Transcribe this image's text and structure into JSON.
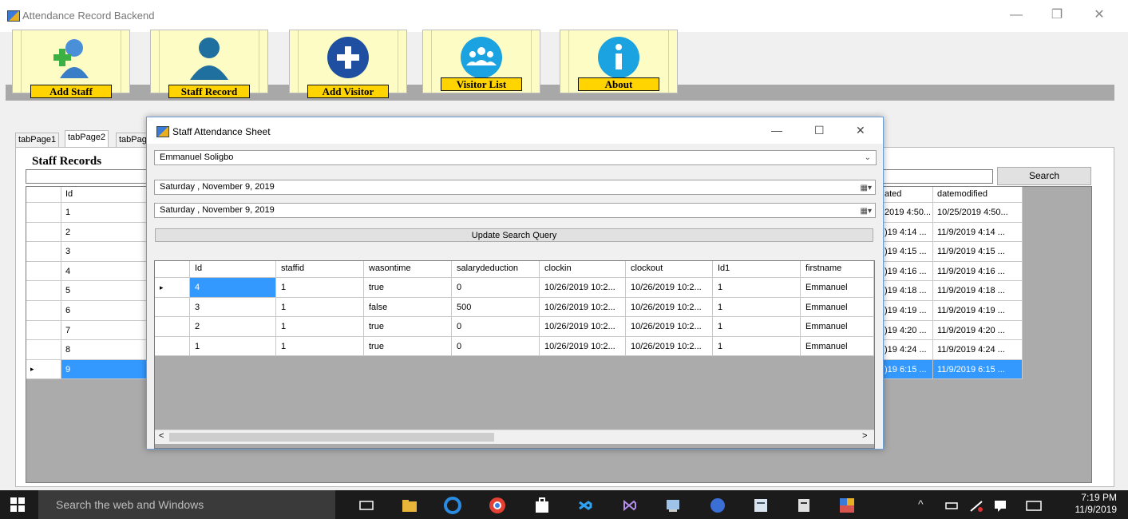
{
  "window": {
    "title": "Attendance Record Backend",
    "minimize": "—",
    "restore": "❐",
    "close": "✕"
  },
  "toolbar": [
    {
      "label": "Add Staff",
      "icon": "add-staff-icon"
    },
    {
      "label": "Staff Record",
      "icon": "person-icon"
    },
    {
      "label": "Add Visitor",
      "icon": "plus-circle-icon"
    },
    {
      "label": "Visitor List",
      "icon": "group-icon"
    },
    {
      "label": "About",
      "icon": "info-icon"
    }
  ],
  "tabs": [
    "tabPage1",
    "tabPage2",
    "tabPag"
  ],
  "staff_records": {
    "title": "Staff Records",
    "search_label": "Search",
    "columns": [
      "Id",
      "ated",
      "datemodified"
    ],
    "rows": [
      {
        "id": "1",
        "created": "2019 4:50...",
        "modified": "10/25/2019 4:50..."
      },
      {
        "id": "2",
        "created": ")19 4:14 ...",
        "modified": "11/9/2019 4:14 ..."
      },
      {
        "id": "3",
        "created": ")19 4:15 ...",
        "modified": "11/9/2019 4:15 ..."
      },
      {
        "id": "4",
        "created": ")19 4:16 ...",
        "modified": "11/9/2019 4:16 ..."
      },
      {
        "id": "5",
        "created": ")19 4:18 ...",
        "modified": "11/9/2019 4:18 ..."
      },
      {
        "id": "6",
        "created": ")19 4:19 ...",
        "modified": "11/9/2019 4:19 ..."
      },
      {
        "id": "7",
        "created": ")19 4:20 ...",
        "modified": "11/9/2019 4:20 ..."
      },
      {
        "id": "8",
        "created": ")19 4:24 ...",
        "modified": "11/9/2019 4:24 ..."
      },
      {
        "id": "9",
        "created": ")19 6:15 ...",
        "modified": "11/9/2019 6:15 ..."
      }
    ],
    "selected_row_marker": "▸"
  },
  "dialog": {
    "title": "Staff Attendance Sheet",
    "minimize": "—",
    "maximize": "☐",
    "close": "✕",
    "staff_select": "Emmanuel Soligbo",
    "date_from": "Saturday  , November  9, 2019",
    "date_to": "Saturday  , November  9, 2019",
    "update_label": "Update Search Query",
    "columns": [
      "Id",
      "staffid",
      "wasontime",
      "salarydeduction",
      "clockin",
      "clockout",
      "Id1",
      "firstname"
    ],
    "rows": [
      [
        "4",
        "1",
        "true",
        "0",
        "10/26/2019 10:2...",
        "10/26/2019 10:2...",
        "1",
        "Emmanuel"
      ],
      [
        "3",
        "1",
        "false",
        "500",
        "10/26/2019 10:2...",
        "10/26/2019 10:2...",
        "1",
        "Emmanuel"
      ],
      [
        "2",
        "1",
        "true",
        "0",
        "10/26/2019 10:2...",
        "10/26/2019 10:2...",
        "1",
        "Emmanuel"
      ],
      [
        "1",
        "1",
        "true",
        "0",
        "10/26/2019 10:2...",
        "10/26/2019 10:2...",
        "1",
        "Emmanuel"
      ]
    ],
    "row_marker": "▸",
    "scroll_left": "<",
    "scroll_right": ">"
  },
  "taskbar": {
    "search_placeholder": "Search the web and Windows",
    "time": "7:19 PM",
    "date": "11/9/2019"
  },
  "colors": {
    "selection": "#3399ff",
    "label_bg": "#ffd400",
    "button_bg": "#fcfcc4",
    "taskbar": "#1b1b1b"
  }
}
